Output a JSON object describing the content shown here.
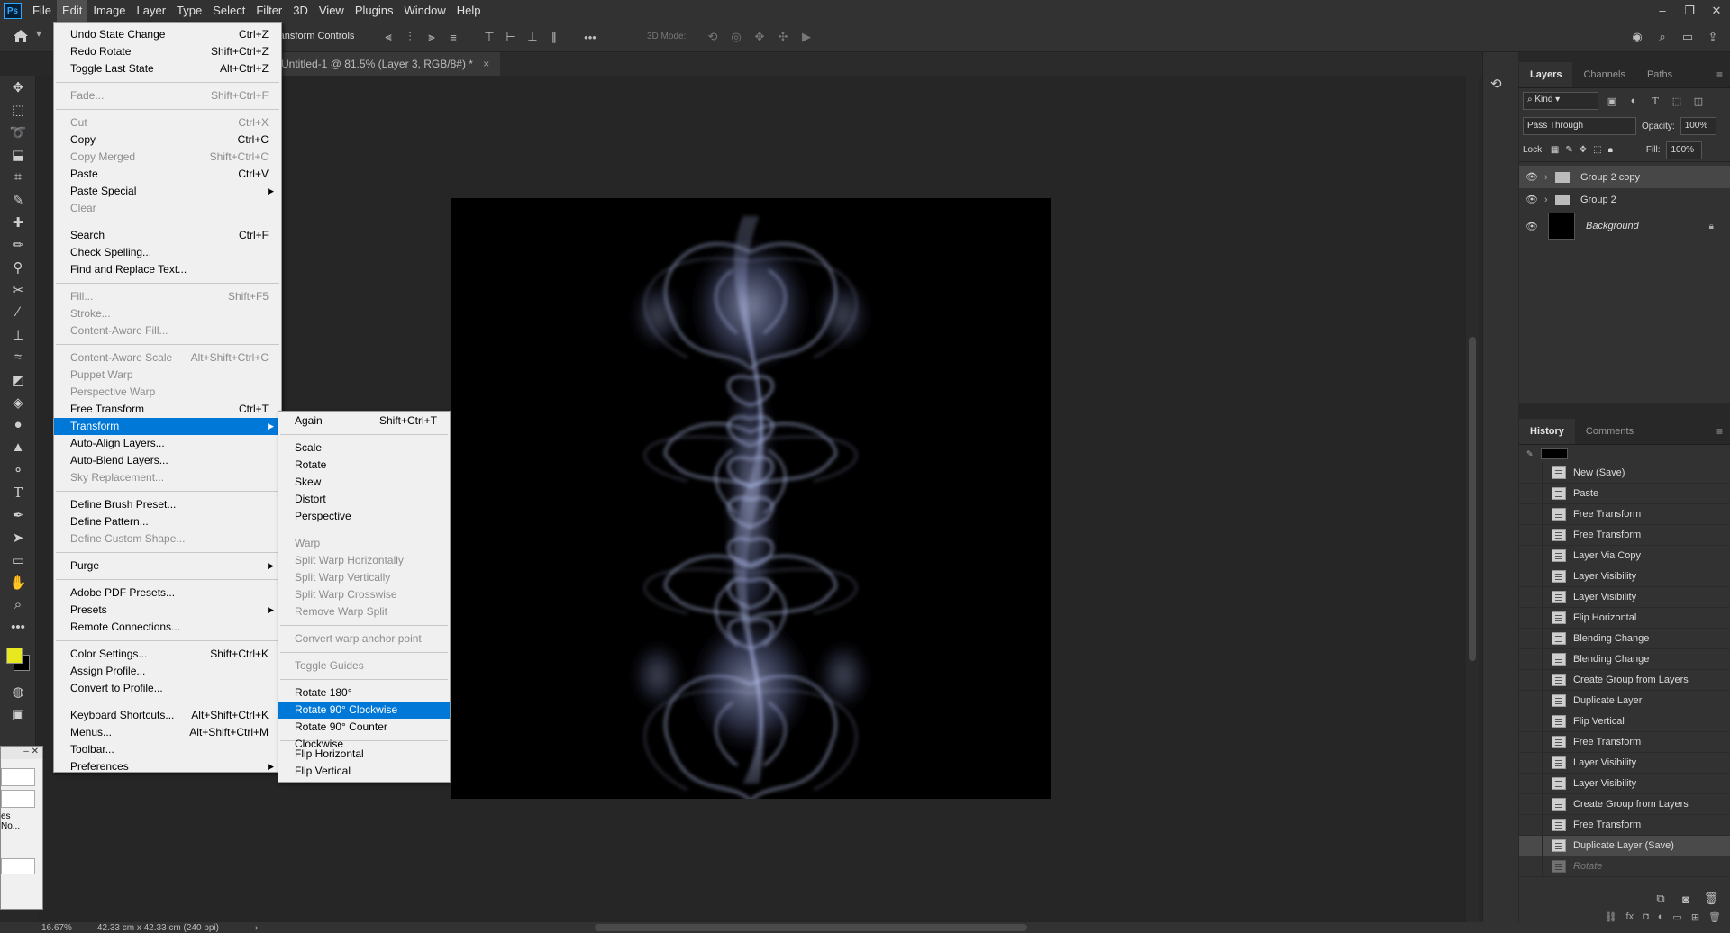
{
  "app": {
    "logo": "Ps",
    "menus": [
      "File",
      "Edit",
      "Image",
      "Layer",
      "Type",
      "Select",
      "Filter",
      "3D",
      "View",
      "Plugins",
      "Window",
      "Help"
    ],
    "active_menu": "Edit"
  },
  "options_bar": {
    "transform_controls": "ransform Controls",
    "three_d_mode": "3D Mode:",
    "more": "•••"
  },
  "document": {
    "tab_title": "Untitled-1 @ 81.5% (Layer 3, RGB/8#) *",
    "tab_close": "×"
  },
  "status": {
    "zoom": "16.67%",
    "doc_info": "42.33 cm x 42.33 cm (240 ppi)"
  },
  "edit_menu": [
    {
      "label": "Undo State Change",
      "shortcut": "Ctrl+Z",
      "enabled": true
    },
    {
      "label": "Redo Rotate",
      "shortcut": "Shift+Ctrl+Z",
      "enabled": true
    },
    {
      "label": "Toggle Last State",
      "shortcut": "Alt+Ctrl+Z",
      "enabled": true
    },
    {
      "sep": true
    },
    {
      "label": "Fade...",
      "shortcut": "Shift+Ctrl+F",
      "enabled": false
    },
    {
      "sep": true
    },
    {
      "label": "Cut",
      "shortcut": "Ctrl+X",
      "enabled": false
    },
    {
      "label": "Copy",
      "shortcut": "Ctrl+C",
      "enabled": true
    },
    {
      "label": "Copy Merged",
      "shortcut": "Shift+Ctrl+C",
      "enabled": false
    },
    {
      "label": "Paste",
      "shortcut": "Ctrl+V",
      "enabled": true
    },
    {
      "label": "Paste Special",
      "shortcut": "",
      "enabled": true,
      "submenu": true
    },
    {
      "label": "Clear",
      "shortcut": "",
      "enabled": false
    },
    {
      "sep": true
    },
    {
      "label": "Search",
      "shortcut": "Ctrl+F",
      "enabled": true
    },
    {
      "label": "Check Spelling...",
      "shortcut": "",
      "enabled": true
    },
    {
      "label": "Find and Replace Text...",
      "shortcut": "",
      "enabled": true
    },
    {
      "sep": true
    },
    {
      "label": "Fill...",
      "shortcut": "Shift+F5",
      "enabled": false
    },
    {
      "label": "Stroke...",
      "shortcut": "",
      "enabled": false
    },
    {
      "label": "Content-Aware Fill...",
      "shortcut": "",
      "enabled": false
    },
    {
      "sep": true
    },
    {
      "label": "Content-Aware Scale",
      "shortcut": "Alt+Shift+Ctrl+C",
      "enabled": false
    },
    {
      "label": "Puppet Warp",
      "shortcut": "",
      "enabled": false
    },
    {
      "label": "Perspective Warp",
      "shortcut": "",
      "enabled": false
    },
    {
      "label": "Free Transform",
      "shortcut": "Ctrl+T",
      "enabled": true
    },
    {
      "label": "Transform",
      "shortcut": "",
      "enabled": true,
      "submenu": true,
      "highlighted": true
    },
    {
      "label": "Auto-Align Layers...",
      "shortcut": "",
      "enabled": true
    },
    {
      "label": "Auto-Blend Layers...",
      "shortcut": "",
      "enabled": true
    },
    {
      "label": "Sky Replacement...",
      "shortcut": "",
      "enabled": false
    },
    {
      "sep": true
    },
    {
      "label": "Define Brush Preset...",
      "shortcut": "",
      "enabled": true
    },
    {
      "label": "Define Pattern...",
      "shortcut": "",
      "enabled": true
    },
    {
      "label": "Define Custom Shape...",
      "shortcut": "",
      "enabled": false
    },
    {
      "sep": true
    },
    {
      "label": "Purge",
      "shortcut": "",
      "enabled": true,
      "submenu": true
    },
    {
      "sep": true
    },
    {
      "label": "Adobe PDF Presets...",
      "shortcut": "",
      "enabled": true
    },
    {
      "label": "Presets",
      "shortcut": "",
      "enabled": true,
      "submenu": true
    },
    {
      "label": "Remote Connections...",
      "shortcut": "",
      "enabled": true
    },
    {
      "sep": true
    },
    {
      "label": "Color Settings...",
      "shortcut": "Shift+Ctrl+K",
      "enabled": true
    },
    {
      "label": "Assign Profile...",
      "shortcut": "",
      "enabled": true
    },
    {
      "label": "Convert to Profile...",
      "shortcut": "",
      "enabled": true
    },
    {
      "sep": true
    },
    {
      "label": "Keyboard Shortcuts...",
      "shortcut": "Alt+Shift+Ctrl+K",
      "enabled": true
    },
    {
      "label": "Menus...",
      "shortcut": "Alt+Shift+Ctrl+M",
      "enabled": true
    },
    {
      "label": "Toolbar...",
      "shortcut": "",
      "enabled": true
    },
    {
      "label": "Preferences",
      "shortcut": "",
      "enabled": true,
      "submenu": true
    }
  ],
  "transform_menu": [
    {
      "label": "Again",
      "shortcut": "Shift+Ctrl+T",
      "enabled": true
    },
    {
      "sep": true
    },
    {
      "label": "Scale",
      "shortcut": "",
      "enabled": true
    },
    {
      "label": "Rotate",
      "shortcut": "",
      "enabled": true
    },
    {
      "label": "Skew",
      "shortcut": "",
      "enabled": true
    },
    {
      "label": "Distort",
      "shortcut": "",
      "enabled": true
    },
    {
      "label": "Perspective",
      "shortcut": "",
      "enabled": true
    },
    {
      "sep": true
    },
    {
      "label": "Warp",
      "shortcut": "",
      "enabled": false
    },
    {
      "label": "Split Warp Horizontally",
      "shortcut": "",
      "enabled": false
    },
    {
      "label": "Split Warp Vertically",
      "shortcut": "",
      "enabled": false
    },
    {
      "label": "Split Warp Crosswise",
      "shortcut": "",
      "enabled": false
    },
    {
      "label": "Remove Warp Split",
      "shortcut": "",
      "enabled": false
    },
    {
      "sep": true
    },
    {
      "label": "Convert warp anchor point",
      "shortcut": "",
      "enabled": false
    },
    {
      "sep": true
    },
    {
      "label": "Toggle Guides",
      "shortcut": "",
      "enabled": false
    },
    {
      "sep": true
    },
    {
      "label": "Rotate 180°",
      "shortcut": "",
      "enabled": true
    },
    {
      "label": "Rotate 90° Clockwise",
      "shortcut": "",
      "enabled": true,
      "highlighted": true
    },
    {
      "label": "Rotate 90° Counter Clockwise",
      "shortcut": "",
      "enabled": true
    },
    {
      "sep": true
    },
    {
      "label": "Flip Horizontal",
      "shortcut": "",
      "enabled": true
    },
    {
      "label": "Flip Vertical",
      "shortcut": "",
      "enabled": true
    }
  ],
  "layers_panel": {
    "tabs": [
      "Layers",
      "Channels",
      "Paths"
    ],
    "filter_kind": "Kind",
    "blend_mode": "Pass Through",
    "opacity_label": "Opacity:",
    "opacity_value": "100%",
    "lock_label": "Lock:",
    "fill_label": "Fill:",
    "fill_value": "100%",
    "layers": [
      {
        "name": "Group 2 copy",
        "type": "group",
        "selected": true
      },
      {
        "name": "Group 2",
        "type": "group",
        "selected": false
      },
      {
        "name": "Background",
        "type": "background",
        "selected": false
      }
    ]
  },
  "history_panel": {
    "tabs": [
      "History",
      "Comments"
    ],
    "items": [
      {
        "label": "New (Save)"
      },
      {
        "label": "Paste"
      },
      {
        "label": "Free Transform"
      },
      {
        "label": "Free Transform"
      },
      {
        "label": "Layer Via Copy"
      },
      {
        "label": "Layer Visibility"
      },
      {
        "label": "Layer Visibility"
      },
      {
        "label": "Flip Horizontal"
      },
      {
        "label": "Blending Change"
      },
      {
        "label": "Blending Change"
      },
      {
        "label": "Create Group from Layers"
      },
      {
        "label": "Duplicate Layer"
      },
      {
        "label": "Flip Vertical"
      },
      {
        "label": "Free Transform"
      },
      {
        "label": "Layer Visibility"
      },
      {
        "label": "Layer Visibility"
      },
      {
        "label": "Create Group from Layers"
      },
      {
        "label": "Free Transform"
      },
      {
        "label": "Duplicate Layer (Save)",
        "selected": true
      },
      {
        "label": "Rotate",
        "undone": true
      }
    ]
  },
  "colors": {
    "foreground": "#e8e820",
    "background": "#000000",
    "highlight": "#0078d7",
    "smoke": "#b8c4f0"
  },
  "small_panel": {
    "line1": "es",
    "line2": "No..."
  }
}
